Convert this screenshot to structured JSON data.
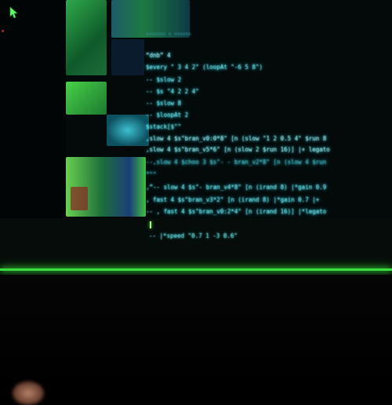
{
  "code": {
    "header_text": "xxxxxxx x xxxxxx",
    "lines": [
      "“dnb” 4",
      "$every \" 3 4 2\" (loopAt \"-6 5 8\")",
      "-- $slow 2",
      "-- $s \"4 2 2 4\"",
      "-- $slow 8",
      "-- $loopAt 2",
      "$stack[$\"\"",
      ",slow 4 $s\"bran_v0:0*8\" [n (slow \"1 2 0.5 4\" $run 8",
      ",slow 4 $s\"bran_v5*6\" [n (slow 2 $run 16)] |+ legato",
      "--,slow 4 $choo 3 $s\"- - bran_v2*8\" [n (slow 4 $run",
      "”\"\"",
      ",”-- slow 4 $s\"- bran_v4*8\" [n (irand 8) |*gain 0.9",
      ", fast 4 $s\"bran_v3*2\" [n (irand 8) |*gain 0.7 |+",
      "-- , fast 4 $s\"bran_v0:2*4\" [n (irand 16)] |*legato",
      "-- ]"
    ]
  },
  "terminal": {
    "prompt_line": "-- |*speed \"0.7 1 -3 0.6\""
  },
  "colors": {
    "code_text": "#7df9ff",
    "accent_glow": "#3ae040",
    "background": "#040a0a"
  }
}
